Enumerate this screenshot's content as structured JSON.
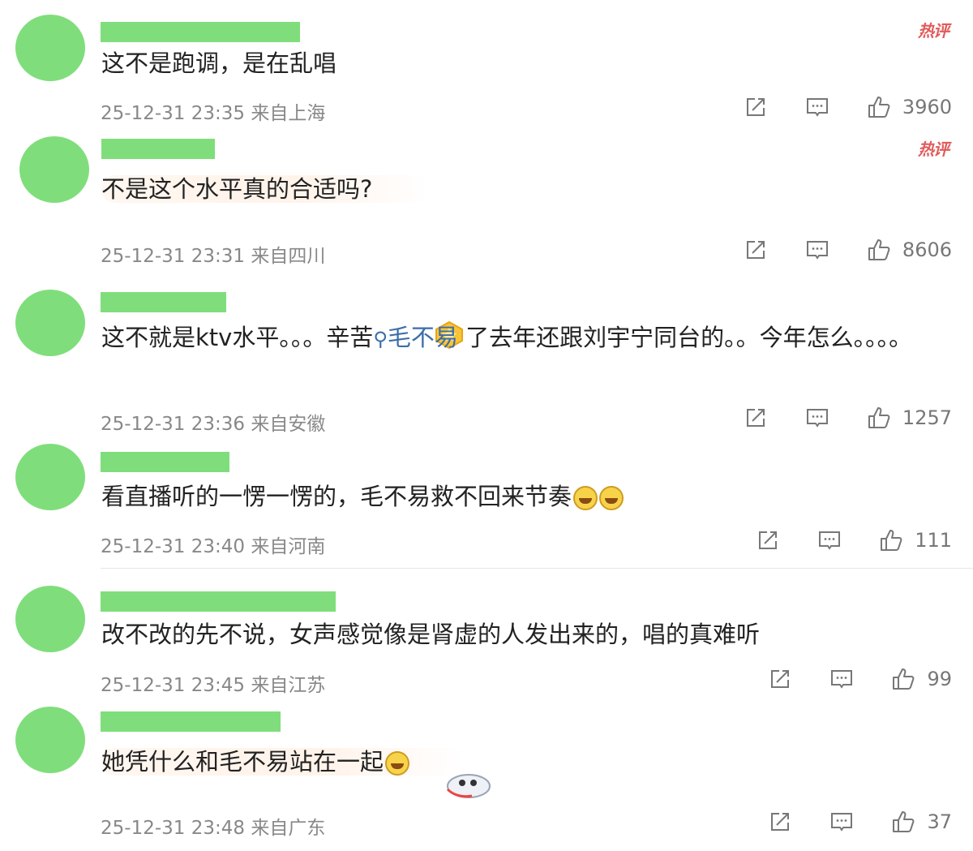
{
  "hot_label": "热评",
  "comments": [
    {
      "text": "这不是跑调，是在乱唱",
      "time": "25-12-31 23:35",
      "location": "来自上海",
      "likes": "3960",
      "hot": true
    },
    {
      "text": "不是这个水平真的合适吗?",
      "time": "25-12-31 23:31",
      "location": "来自四川",
      "likes": "8606",
      "hot": true
    },
    {
      "text_before": "这不就是ktv水平。。。辛苦",
      "mention": "毛不易",
      "text_after": " 了去年还跟刘宇宁同台的。。今年怎么。。。。",
      "time": "25-12-31 23:36",
      "location": "来自安徽",
      "likes": "1257",
      "hot": false
    },
    {
      "text": "看直播听的一愣一愣的，毛不易救不回来节奏",
      "time": "25-12-31 23:40",
      "location": "来自河南",
      "likes": "111",
      "hot": false
    },
    {
      "text": "改不改的先不说，女声感觉像是肾虚的人发出来的，唱的真难听",
      "time": "25-12-31 23:45",
      "location": "来自江苏",
      "likes": "99",
      "hot": false
    },
    {
      "text": "她凭什么和毛不易站在一起",
      "time": "25-12-31 23:48",
      "location": "来自广东",
      "likes": "37",
      "hot": false
    }
  ],
  "icons": {
    "share": "share-icon",
    "comment": "comment-icon",
    "like": "thumbs-up-icon",
    "search": "search-icon"
  },
  "colors": {
    "avatar": "#7fde7b",
    "hot": "#e15b5b",
    "mention": "#3b6ea8",
    "meta": "#888888"
  }
}
